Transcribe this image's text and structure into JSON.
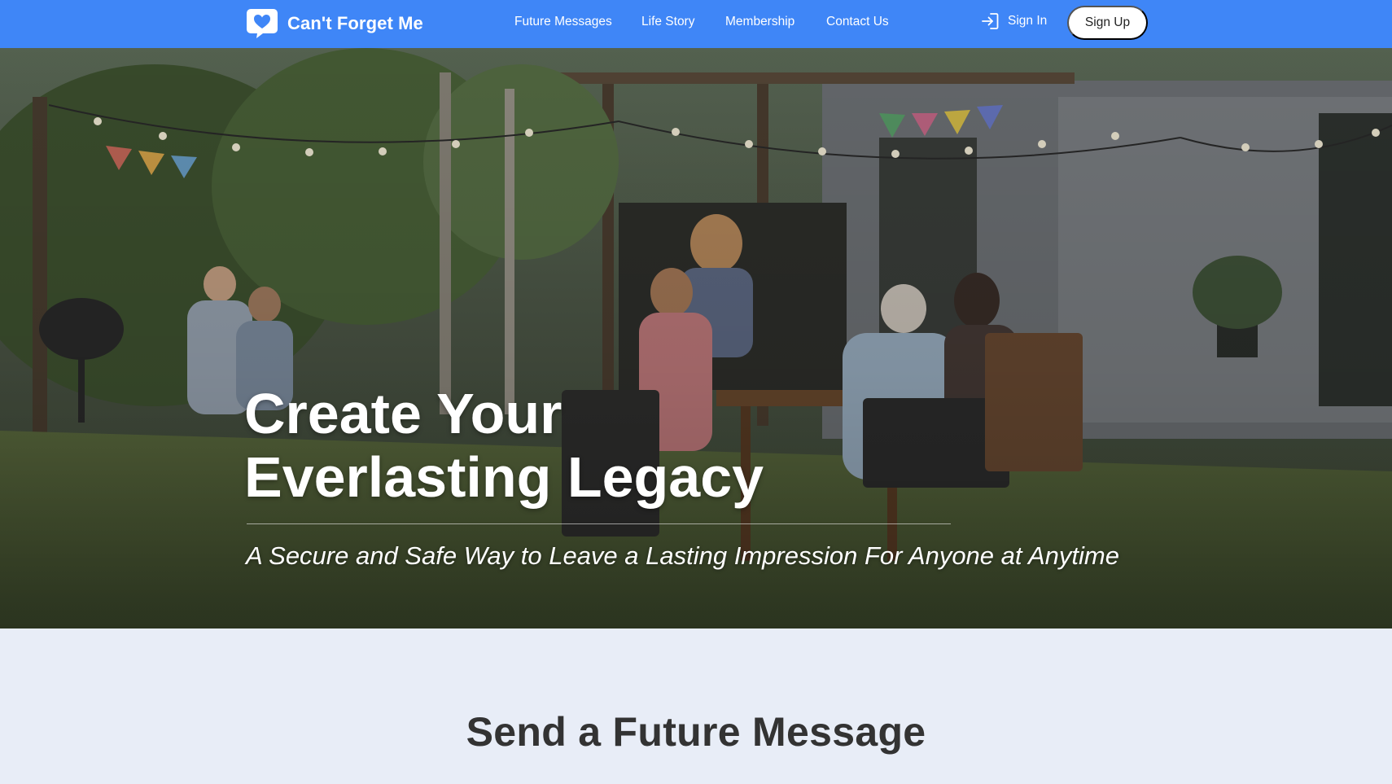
{
  "brand": {
    "name": "Can't Forget Me",
    "logo_icon": "heart-speech-bubble-icon"
  },
  "nav": {
    "links": [
      "Future Messages",
      "Life Story",
      "Membership",
      "Contact Us"
    ],
    "sign_in_label": "Sign In",
    "sign_in_icon": "sign-in-arrow-icon",
    "sign_up_label": "Sign Up"
  },
  "hero": {
    "title_line1": "Create Your",
    "title_line2": "Everlasting Legacy",
    "subtitle": "A Secure and Safe Way to Leave a Lasting Impression For Anyone at Anytime"
  },
  "section": {
    "title": "Send a Future Message"
  },
  "colors": {
    "navbar": "#3f86f7",
    "section_bg": "#e8edf7",
    "heading_text": "#333333"
  }
}
